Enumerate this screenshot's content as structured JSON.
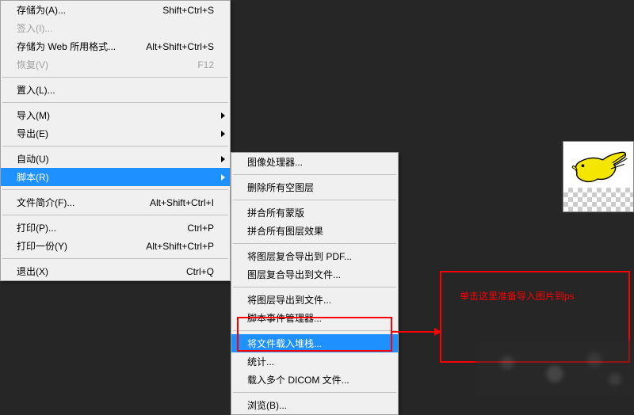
{
  "main_menu": {
    "items": [
      {
        "label": "存储为(A)...",
        "shortcut": "Shift+Ctrl+S",
        "disabled": false
      },
      {
        "label": "签入(I)...",
        "shortcut": "",
        "disabled": true
      },
      {
        "label": "存储为 Web 所用格式...",
        "shortcut": "Alt+Shift+Ctrl+S",
        "disabled": false
      },
      {
        "label": "恢复(V)",
        "shortcut": "F12",
        "disabled": true
      }
    ],
    "group2": [
      {
        "label": "置入(L)...",
        "shortcut": "",
        "disabled": false
      }
    ],
    "group3": [
      {
        "label": "导入(M)",
        "shortcut": "",
        "disabled": false,
        "arrow": true
      },
      {
        "label": "导出(E)",
        "shortcut": "",
        "disabled": false,
        "arrow": true
      }
    ],
    "group4": [
      {
        "label": "自动(U)",
        "shortcut": "",
        "disabled": false,
        "arrow": true
      },
      {
        "label": "脚本(R)",
        "shortcut": "",
        "disabled": false,
        "arrow": true,
        "highlight": true
      }
    ],
    "group5": [
      {
        "label": "文件简介(F)...",
        "shortcut": "Alt+Shift+Ctrl+I",
        "disabled": false
      }
    ],
    "group6": [
      {
        "label": "打印(P)...",
        "shortcut": "Ctrl+P",
        "disabled": false
      },
      {
        "label": "打印一份(Y)",
        "shortcut": "Alt+Shift+Ctrl+P",
        "disabled": false
      }
    ],
    "group7": [
      {
        "label": "退出(X)",
        "shortcut": "Ctrl+Q",
        "disabled": false
      }
    ]
  },
  "submenu": {
    "g1": [
      {
        "label": "图像处理器..."
      }
    ],
    "g2": [
      {
        "label": "删除所有空图层"
      }
    ],
    "g3": [
      {
        "label": "拼合所有蒙版"
      },
      {
        "label": "拼合所有图层效果"
      }
    ],
    "g4": [
      {
        "label": "将图层复合导出到 PDF..."
      },
      {
        "label": "图层复合导出到文件..."
      }
    ],
    "g5": [
      {
        "label": "将图层导出到文件..."
      },
      {
        "label": "脚本事件管理器..."
      }
    ],
    "g6": [
      {
        "label": "将文件载入堆栈...",
        "highlight": true
      },
      {
        "label": "统计..."
      },
      {
        "label": "载入多个 DICOM 文件..."
      }
    ],
    "g7": [
      {
        "label": "浏览(B)..."
      }
    ]
  },
  "annotation": {
    "text": "单击这里准备导入图片到ps"
  }
}
